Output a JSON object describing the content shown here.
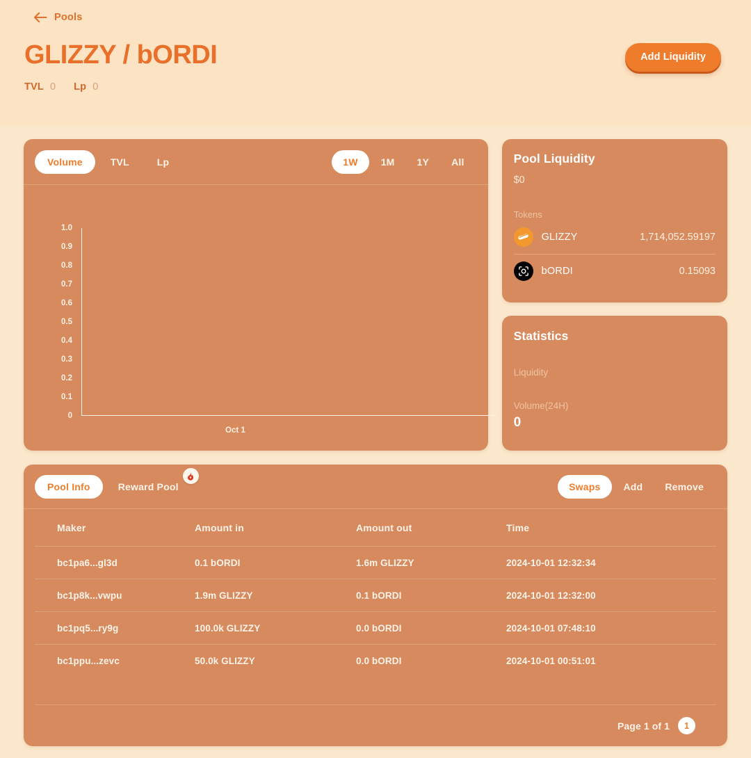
{
  "header": {
    "back_label": "Pools",
    "back_icon": "arrow-left-icon",
    "title": "GLIZZY / bORDI",
    "stats": [
      {
        "label": "TVL",
        "value": "0"
      },
      {
        "label": "Lp",
        "value": "0"
      }
    ],
    "add_liquidity_label": "Add Liquidity"
  },
  "chart_panel": {
    "metric_tabs": [
      {
        "label": "Volume",
        "active": true
      },
      {
        "label": "TVL",
        "active": false
      },
      {
        "label": "Lp",
        "active": false
      }
    ],
    "range_tabs": [
      {
        "label": "1W",
        "active": true
      },
      {
        "label": "1M",
        "active": false
      },
      {
        "label": "1Y",
        "active": false
      },
      {
        "label": "All",
        "active": false
      }
    ]
  },
  "chart_data": {
    "type": "line",
    "title": "Volume",
    "xlabel": "",
    "ylabel": "",
    "x": [
      "Oct 1"
    ],
    "series": [
      {
        "name": "Volume",
        "values": [
          0
        ]
      }
    ],
    "values": [
      0
    ],
    "categories": [
      "Oct 1"
    ],
    "ylim": [
      0,
      1.0
    ],
    "yticks": [
      "1.0",
      "0.9",
      "0.8",
      "0.7",
      "0.6",
      "0.5",
      "0.4",
      "0.3",
      "0.2",
      "0.1",
      "0"
    ],
    "xticks": [
      "Oct 1"
    ],
    "grid": false,
    "legend": false,
    "empty": true
  },
  "pool_liquidity": {
    "title": "Pool Liquidity",
    "amount": "$0",
    "tokens_label": "Tokens",
    "tokens": [
      {
        "icon": "glizzy-token-icon",
        "name": "GLIZZY",
        "amount": "1,714,052.59197"
      },
      {
        "icon": "bordi-token-icon",
        "name": "bORDI",
        "amount": "0.15093"
      }
    ]
  },
  "statistics": {
    "title": "Statistics",
    "liquidity_label": "Liquidity",
    "liquidity_value": "",
    "volume_label": "Volume(24H)",
    "volume_value": "0"
  },
  "activity_panel": {
    "left_tabs": [
      {
        "label": "Pool Info",
        "active": true,
        "badge": null
      },
      {
        "label": "Reward Pool",
        "active": false,
        "badge": "fire-icon"
      }
    ],
    "right_tabs": [
      {
        "label": "Swaps",
        "active": true
      },
      {
        "label": "Add",
        "active": false
      },
      {
        "label": "Remove",
        "active": false
      }
    ],
    "columns": [
      "Maker",
      "Amount in",
      "Amount out",
      "Time"
    ],
    "rows": [
      {
        "maker": "bc1pa6...gl3d",
        "amount_in": "0.1 bORDI",
        "amount_out": "1.6m GLIZZY",
        "time": "2024-10-01 12:32:34"
      },
      {
        "maker": "bc1p8k...vwpu",
        "amount_in": "1.9m GLIZZY",
        "amount_out": "0.1 bORDI",
        "time": "2024-10-01 12:32:00"
      },
      {
        "maker": "bc1pq5...ry9g",
        "amount_in": "100.0k GLIZZY",
        "amount_out": "0.0 bORDI",
        "time": "2024-10-01 07:48:10"
      },
      {
        "maker": "bc1ppu...zevc",
        "amount_in": "50.0k GLIZZY",
        "amount_out": "0.0 bORDI",
        "time": "2024-10-01 00:51:01"
      }
    ],
    "pagination": {
      "text": "Page 1 of 1",
      "current_page": "1"
    }
  },
  "colors": {
    "page_background": "#fbe7cb",
    "header_background": "#fce3c4",
    "card": "#d78a5d",
    "accent_orange": "#ef7c2b",
    "title_orange": "#e8702a",
    "white": "#ffffff",
    "muted_text": "#efc3a3",
    "divider": "#e3a176"
  }
}
